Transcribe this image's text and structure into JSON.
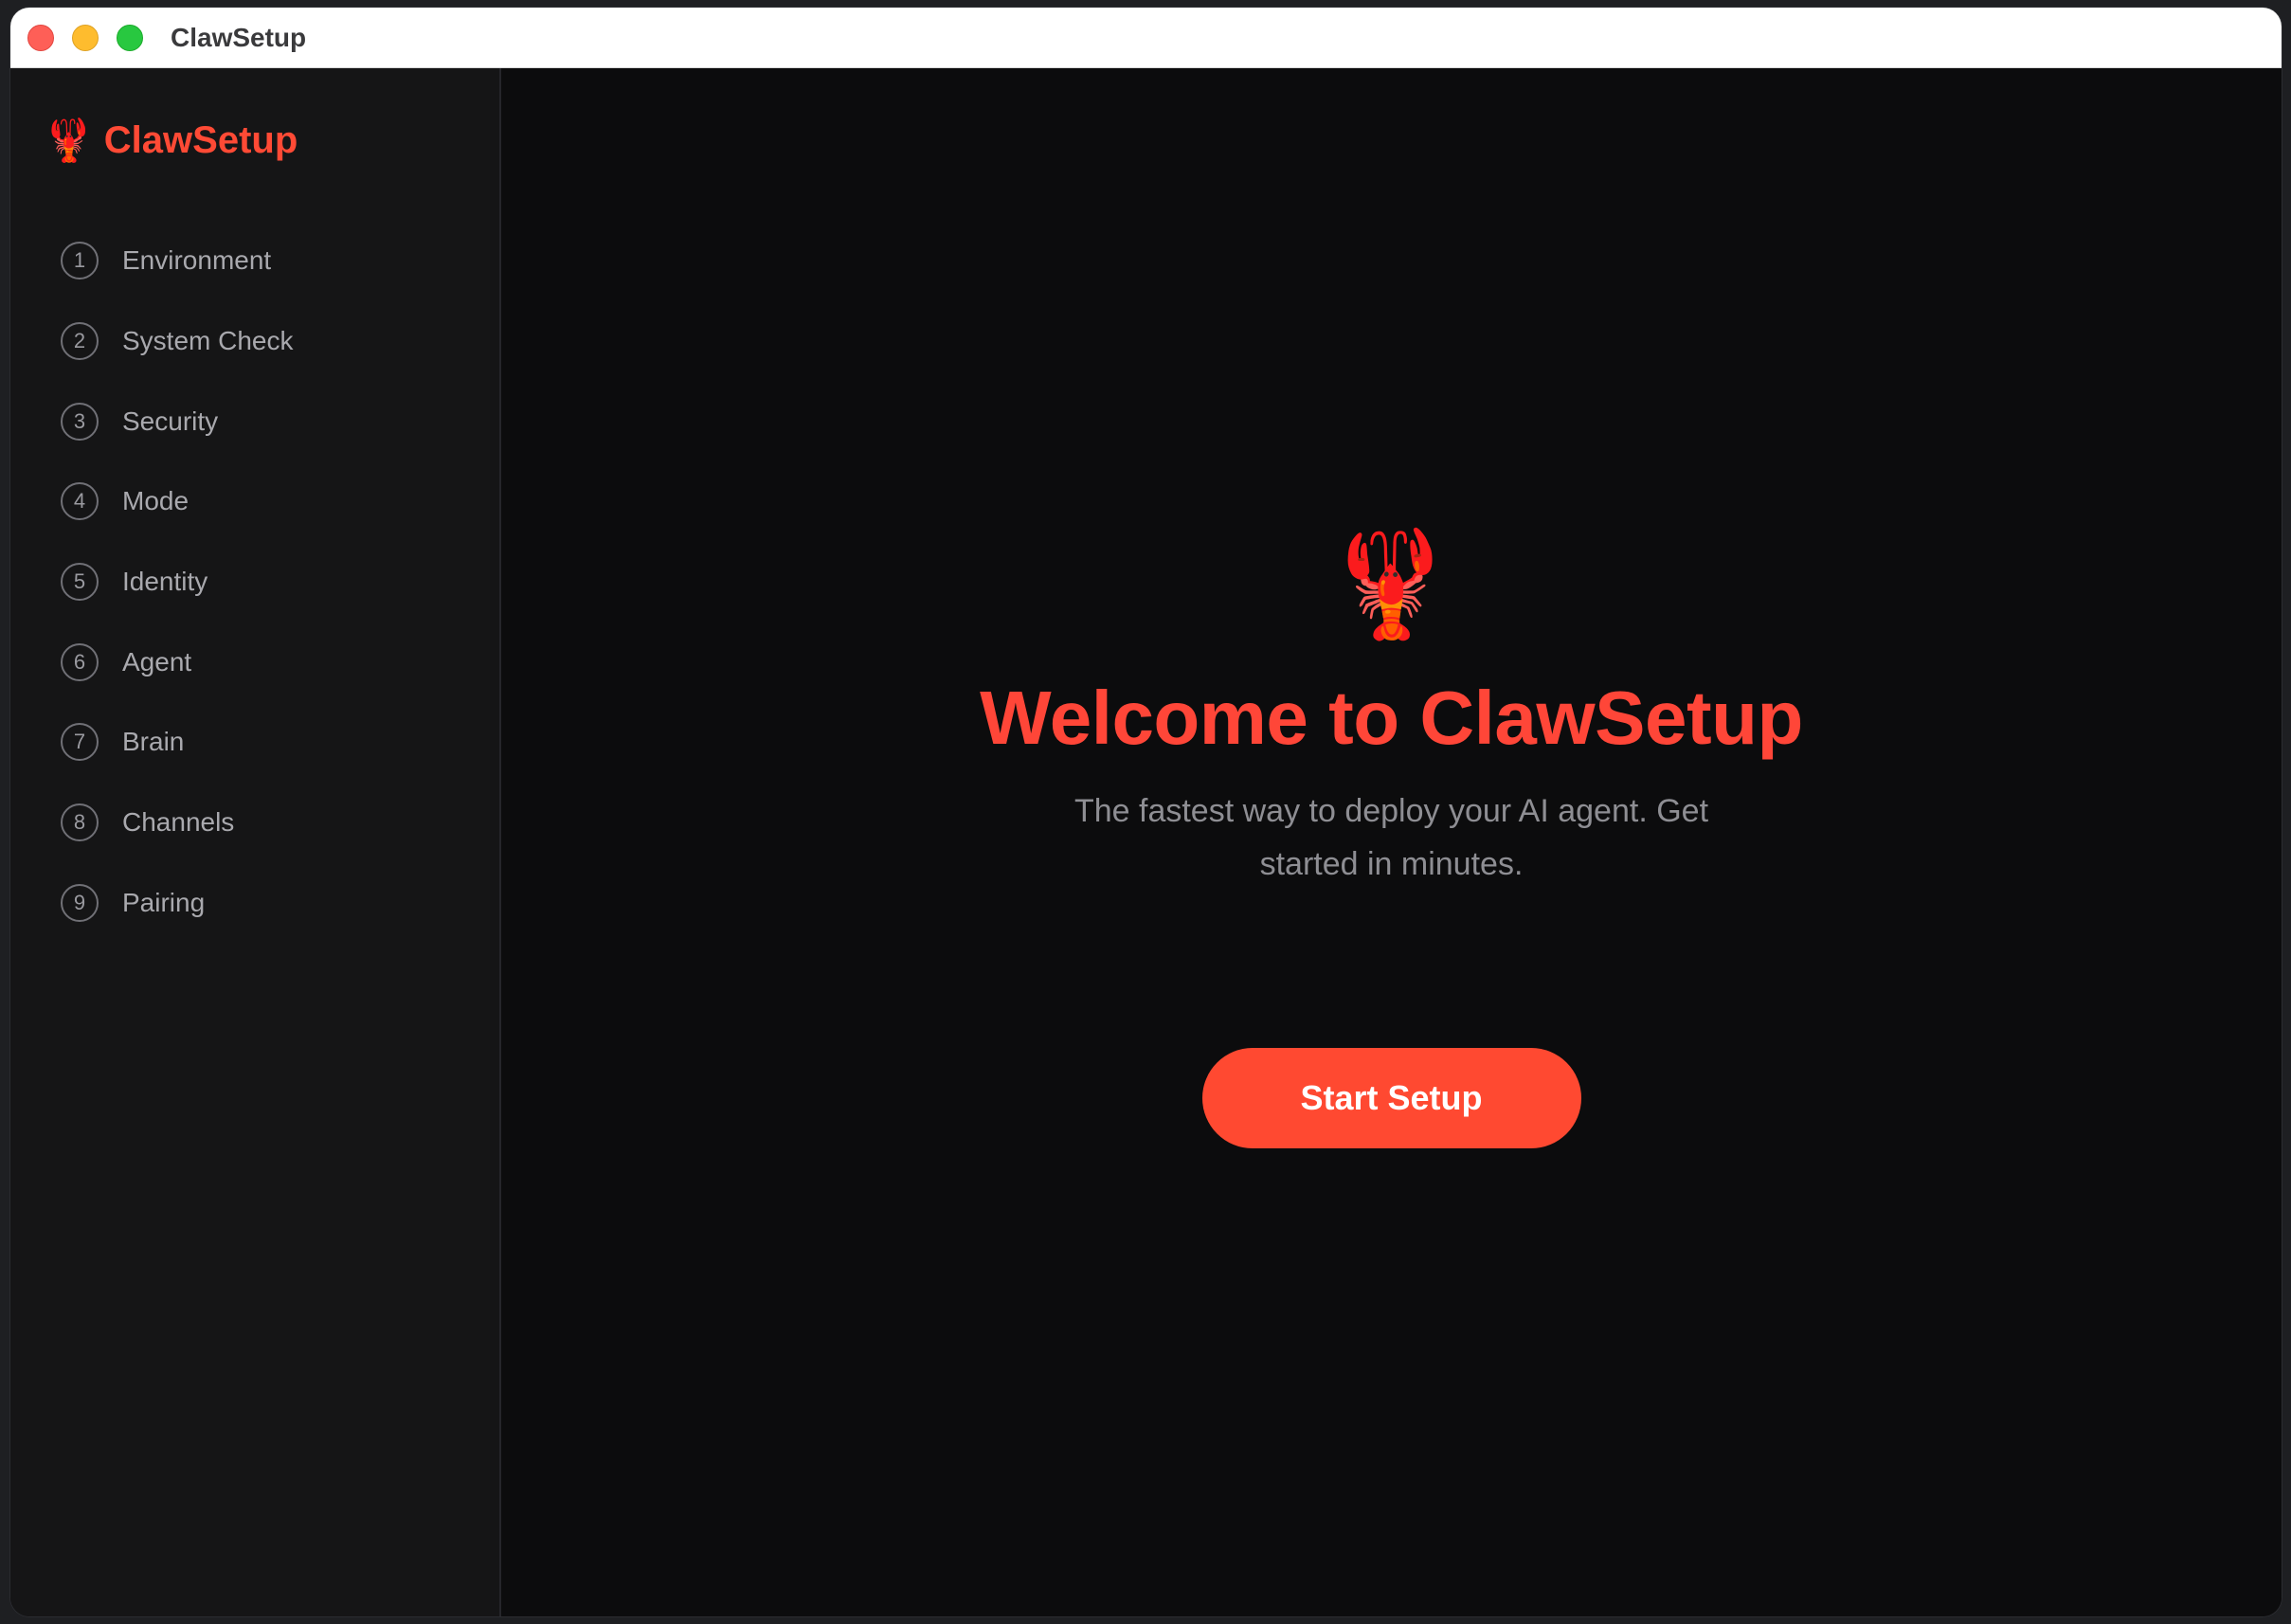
{
  "window": {
    "title": "ClawSetup"
  },
  "sidebar": {
    "brand": {
      "icon": "lobster-icon",
      "name": "ClawSetup"
    },
    "steps": [
      {
        "number": "1",
        "label": "Environment"
      },
      {
        "number": "2",
        "label": "System Check"
      },
      {
        "number": "3",
        "label": "Security"
      },
      {
        "number": "4",
        "label": "Mode"
      },
      {
        "number": "5",
        "label": "Identity"
      },
      {
        "number": "6",
        "label": "Agent"
      },
      {
        "number": "7",
        "label": "Brain"
      },
      {
        "number": "8",
        "label": "Channels"
      },
      {
        "number": "9",
        "label": "Pairing"
      }
    ]
  },
  "main": {
    "hero_icon": "lobster-icon",
    "title": "Welcome to ClawSetup",
    "subtitle": "The fastest way to deploy your AI agent. Get started in minutes.",
    "start_button": "Start Setup"
  },
  "colors": {
    "accent": "#ff4a35",
    "sidebar_bg": "#151516",
    "main_bg": "#0c0c0d"
  }
}
